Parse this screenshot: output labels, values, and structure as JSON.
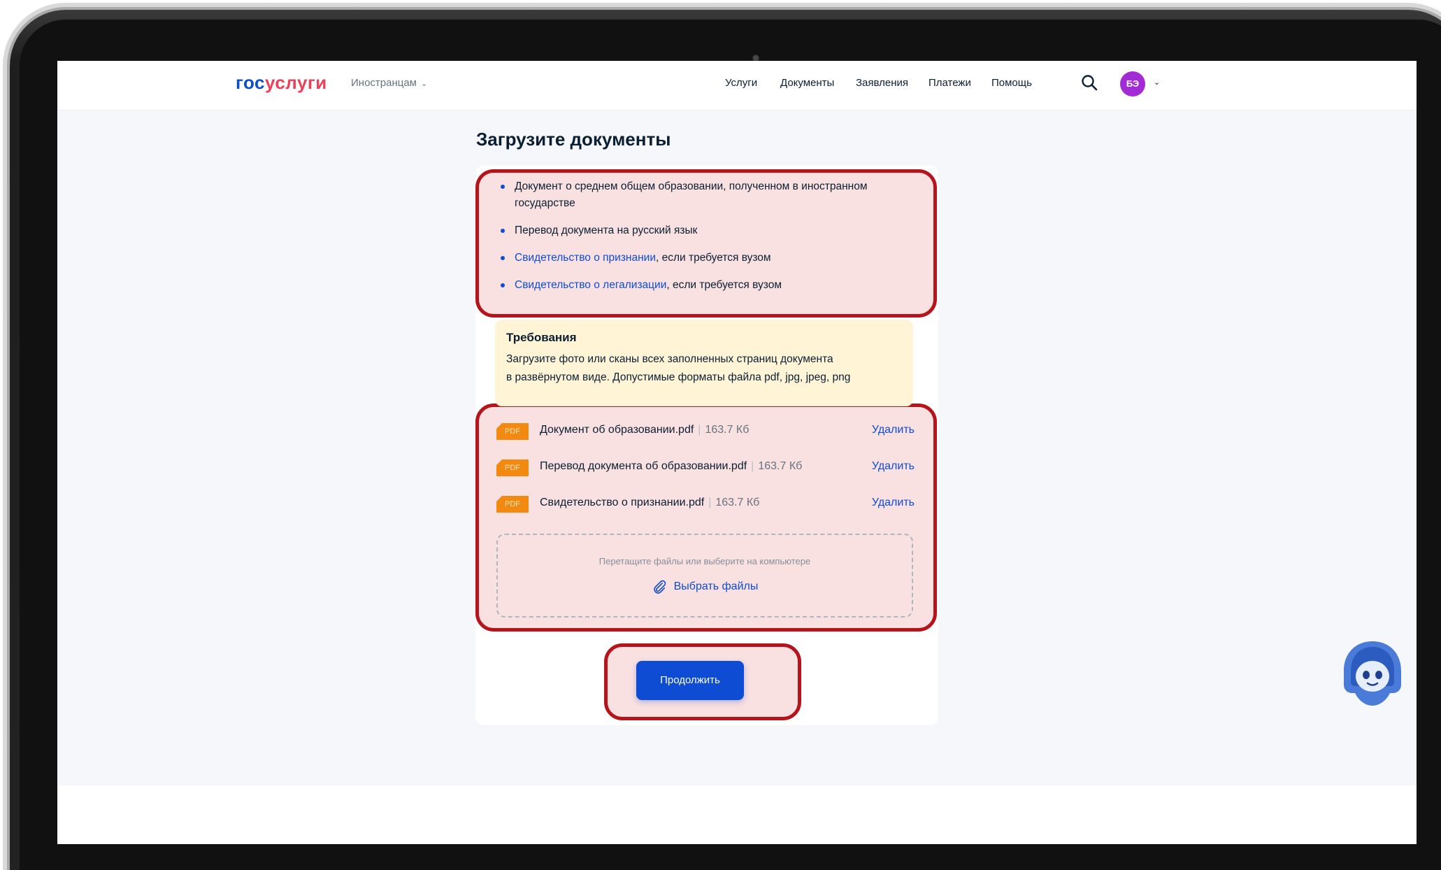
{
  "header": {
    "logo_part1": "гос",
    "logo_part2": "услуги",
    "foreign_menu": "Иностранцам",
    "nav": [
      "Услуги",
      "Документы",
      "Заявления",
      "Платежи",
      "Помощь"
    ],
    "avatar_initials": "БЭ"
  },
  "main": {
    "title": "Загрузите документы",
    "documents": [
      {
        "text": "Документ о среднем общем образовании, полученном в иностранном государстве"
      },
      {
        "text": "Перевод документа на русский язык"
      },
      {
        "link": "Свидетельство о признании",
        "text": ", если требуется вузом"
      },
      {
        "link": "Свидетельство о легализации",
        "text": ", если требуется вузом"
      }
    ],
    "requirements": {
      "title": "Требования",
      "line1": "Загрузите фото или сканы всех заполненных страниц документа",
      "line2": "в развёрнутом виде. Допустимые форматы файла pdf, jpg, jpeg, png"
    },
    "files": [
      {
        "badge": "PDF",
        "name": "Документ об образовании.pdf",
        "size": "163.7 Кб",
        "action": "Удалить"
      },
      {
        "badge": "PDF",
        "name": "Перевод документа об образовании.pdf",
        "size": "163.7 Кб",
        "action": "Удалить"
      },
      {
        "badge": "PDF",
        "name": "Свидетельство о признании.pdf",
        "size": "163.7 Кб",
        "action": "Удалить"
      }
    ],
    "dropzone": {
      "hint": "Перетащите файлы или выберите на компьютере",
      "choose_label": "Выбрать файлы"
    },
    "continue_label": "Продолжить"
  },
  "colors": {
    "accent": "#0d4cd3",
    "logo_red": "#ee3f58",
    "pdf_badge": "#f28a12",
    "highlight_border": "#b5141a",
    "requirements_bg": "#fff4d6",
    "avatar": "#a22bd6"
  },
  "icons": {
    "search": "search-icon",
    "attach": "paperclip-icon",
    "assistant": "robot-assistant-icon"
  }
}
